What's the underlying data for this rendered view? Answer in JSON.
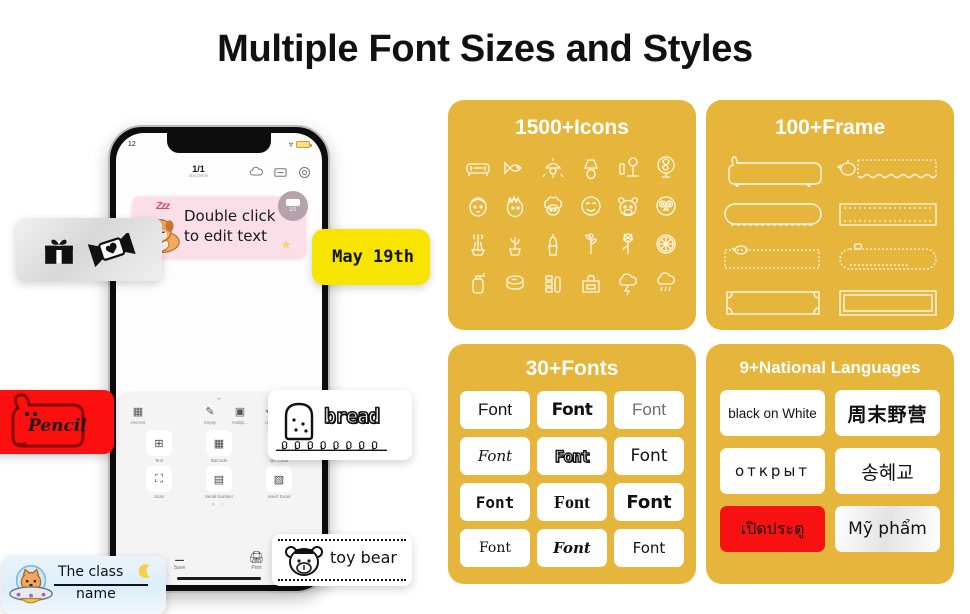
{
  "page": {
    "title": "Multiple Font Sizes and Styles"
  },
  "phone": {
    "status": {
      "time": "12",
      "wifi": "wifi-icon",
      "battery": "battery-icon"
    },
    "topbar": {
      "page_count": "1/1",
      "page_size": "40x14mm",
      "icons": [
        "cloud-save-icon",
        "label-size-icon",
        "settings-gear-icon"
      ]
    },
    "canvas_label": {
      "text_line1": "Double click",
      "text_line2": "to edit text",
      "sticker": "sleeping-dog-sticker",
      "zzz": "Zzz",
      "badge_count": "1/1"
    },
    "sheet": {
      "quick_actions": [
        {
          "label": "element",
          "icon": "grid-icon"
        },
        {
          "label": "Empty",
          "icon": "eraser-icon"
        },
        {
          "label": "Multipl...",
          "icon": "multiply-icon"
        },
        {
          "label": "Undo",
          "icon": "undo-icon"
        },
        {
          "label": "Remove",
          "icon": "redo-icon"
        }
      ],
      "tools": [
        {
          "label": "Text",
          "icon": "text-box-icon"
        },
        {
          "label": "Barcode",
          "icon": "barcode-icon"
        },
        {
          "label": "QR Code",
          "icon": "qr-code-icon"
        },
        {
          "label": "Scan",
          "icon": "scan-frame-icon"
        },
        {
          "label": "Serial Number",
          "icon": "serial-number-icon"
        },
        {
          "label": "Insert Excel",
          "icon": "excel-icon"
        }
      ],
      "pager_dots": "● ○",
      "bottom": [
        {
          "label": "Save",
          "icon": "save-icon"
        },
        {
          "label": "Print",
          "icon": "printer-icon"
        }
      ]
    }
  },
  "stickers": {
    "gift": {
      "icons": [
        "gift-box-icon",
        "candy-heart-icon"
      ]
    },
    "may": {
      "text": "May 19th"
    },
    "pencil": {
      "text": "Pencil",
      "frame": "dog-outline-frame"
    },
    "bread": {
      "text": "bread",
      "icon": "bread-slice-icon",
      "border": "flower-row-border"
    },
    "toy_bear": {
      "text": "toy bear",
      "icon": "bear-face-icon",
      "border": "dotted-leaf-border"
    },
    "class": {
      "line1": "The class",
      "line2": "name",
      "icon": "cat-ufo-sticker",
      "accent": "moon-icon"
    }
  },
  "panels": {
    "icons": {
      "title": "1500+Icons",
      "items": [
        "sofa-icon",
        "fish-food-icon",
        "pendant-lamp-icon",
        "table-lamp-icon",
        "floor-lamp-icon",
        "electric-fan-icon",
        "boy-face-icon",
        "spiky-hair-face-icon",
        "curly-hair-face-icon",
        "smiling-face-icon",
        "cow-face-icon",
        "owl-face-icon",
        "potted-flower-icon",
        "cactus-pot-icon",
        "succulent-pot-icon",
        "sprout-icon",
        "dandelion-icon",
        "citrus-slice-icon",
        "lotion-pump-icon",
        "powder-compact-icon",
        "eyeshadow-palette-icon",
        "cosmetic-case-icon",
        "thunder-cloud-icon",
        "rain-cloud-icon"
      ]
    },
    "frames": {
      "title": "100+Frame",
      "items": [
        "bunny-banner-frame",
        "bird-dashed-frame",
        "rounded-stitch-frame",
        "double-line-frame",
        "dotted-bird-frame",
        "leaf-pill-frame",
        "corner-ornament-frame",
        "double-border-frame"
      ]
    },
    "fonts": {
      "title": "30+Fonts",
      "samples": [
        {
          "text": "Font",
          "style": "f1"
        },
        {
          "text": "Font",
          "style": "f2"
        },
        {
          "text": "Font",
          "style": "f3"
        },
        {
          "text": "Font",
          "style": "f4"
        },
        {
          "text": "Font",
          "style": "f5"
        },
        {
          "text": "Font",
          "style": "f6"
        },
        {
          "text": "Font",
          "style": "f7"
        },
        {
          "text": "Font",
          "style": "f8"
        },
        {
          "text": "Font",
          "style": "f9"
        },
        {
          "text": "Font",
          "style": "f10"
        },
        {
          "text": "Font",
          "style": "f11"
        },
        {
          "text": "Font",
          "style": "f12"
        }
      ]
    },
    "languages": {
      "title": "9+National Languages",
      "samples": [
        {
          "text": "black on White",
          "variant": "small"
        },
        {
          "text": "周末野营",
          "variant": "cjk"
        },
        {
          "text": "открыт",
          "variant": "cyr"
        },
        {
          "text": "송혜교",
          "variant": "kor"
        },
        {
          "text": "เปิดประตู",
          "variant": "red"
        },
        {
          "text": "Mỹ phẩm",
          "variant": "grad"
        }
      ]
    }
  },
  "colors": {
    "panel_bg": "#e6b63c",
    "yellow_label": "#f7e500",
    "red_label": "#fb0f0f",
    "pink_label": "#fbdfe8",
    "title": "#111111"
  }
}
